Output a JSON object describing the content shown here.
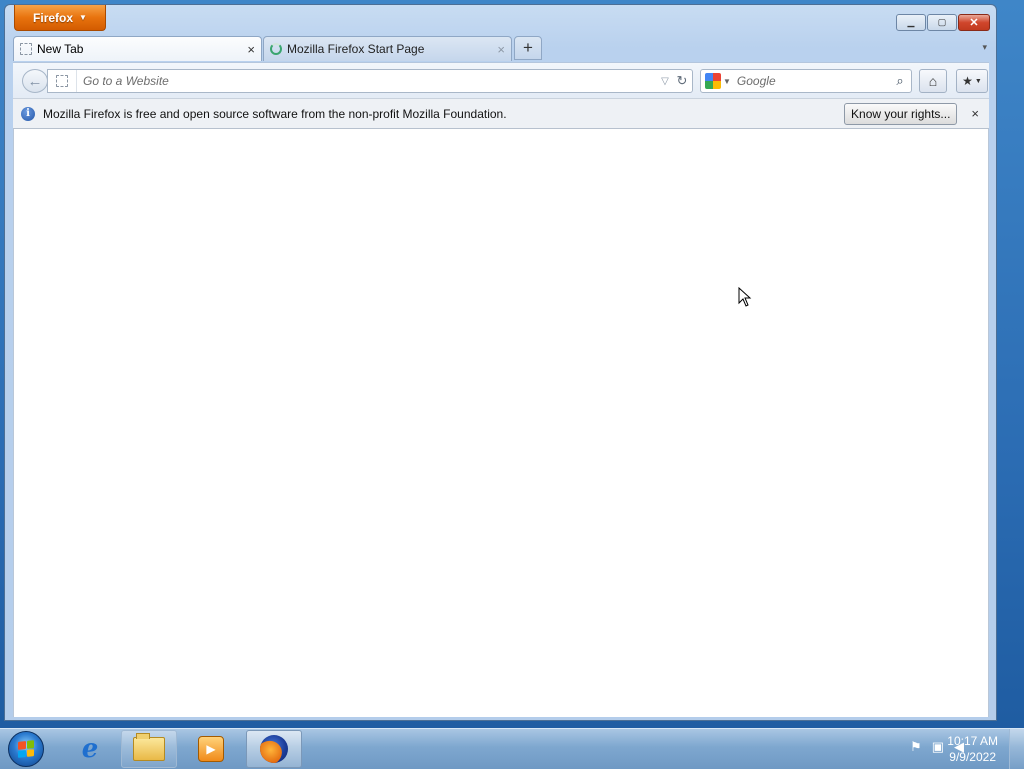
{
  "app_button": {
    "label": "Firefox"
  },
  "window_controls": {
    "minimize": "▭",
    "maximize": "□",
    "close": "✕"
  },
  "tabs": [
    {
      "label": "New Tab",
      "active": true
    },
    {
      "label": "Mozilla Firefox Start Page",
      "active": false
    }
  ],
  "tab_close_glyph": "×",
  "new_tab_glyph": "+",
  "navbar": {
    "back_glyph": "←",
    "url_placeholder": "Go to a Website",
    "url_value": "",
    "search_engine": "Google",
    "search_placeholder": "Google",
    "search_value": ""
  },
  "notification": {
    "message": "Mozilla Firefox is free and open source software from the non-profit Mozilla Foundation.",
    "button_label": "Know your rights...",
    "close_glyph": "×"
  },
  "taskbar": {
    "pinned": [
      "Internet Explorer",
      "Windows Explorer",
      "Windows Media Player",
      "Mozilla Firefox"
    ],
    "clock_time": "10:17 AM",
    "clock_date": "9/9/2022"
  },
  "colors": {
    "firefox_orange": "#e8730e",
    "desktop_blue": "#2b6cb3",
    "window_frame": "#b9d1ee"
  }
}
